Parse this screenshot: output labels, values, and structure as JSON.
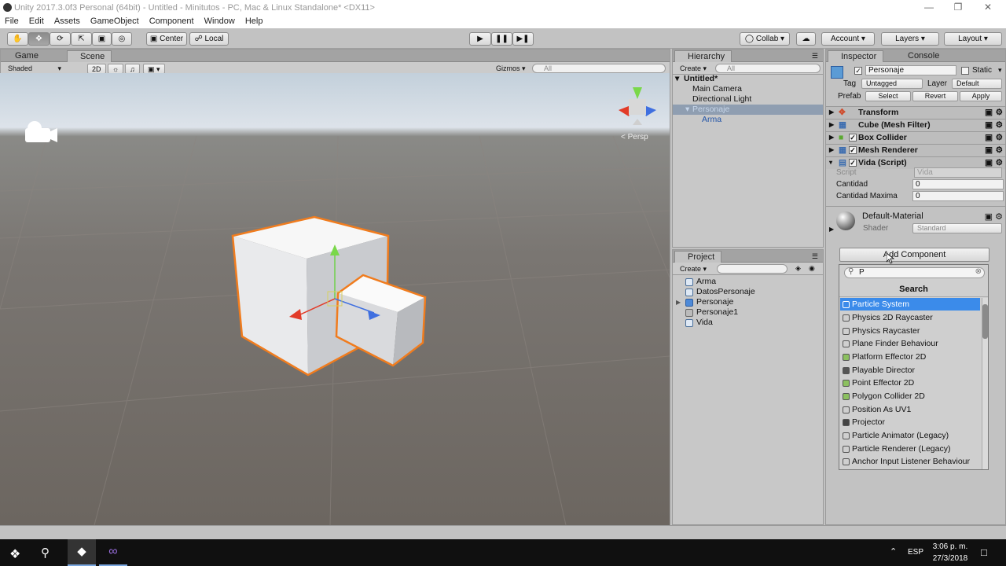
{
  "window": {
    "title": "Unity 2017.3.0f3 Personal (64bit) - Untitled - Minitutos - PC, Mac & Linux Standalone* <DX11>"
  },
  "menu": [
    "File",
    "Edit",
    "Assets",
    "GameObject",
    "Component",
    "Window",
    "Help"
  ],
  "toolbar": {
    "pivot": "Center",
    "space": "Local",
    "collab": "Collab",
    "account": "Account",
    "layers": "Layers",
    "layout": "Layout"
  },
  "scene_panel": {
    "tabs": [
      "Game",
      "Scene"
    ],
    "shading": "Shaded",
    "mode_2d": "2D",
    "gizmos": "Gizmos",
    "search_placeholder": "All",
    "persp_label": "< Persp"
  },
  "hierarchy": {
    "tab": "Hierarchy",
    "create": "Create",
    "search_placeholder": "All",
    "scene_name": "Untitled*",
    "items": [
      "Main Camera",
      "Directional Light",
      "Personaje",
      "Arma"
    ]
  },
  "project": {
    "tab": "Project",
    "create": "Create",
    "items": [
      "Arma",
      "DatosPersonaje",
      "Personaje",
      "Personaje1",
      "Vida"
    ]
  },
  "inspector": {
    "tabs": [
      "Inspector",
      "Console"
    ],
    "object_name": "Personaje",
    "static_label": "Static",
    "tag_label": "Tag",
    "tag_value": "Untagged",
    "layer_label": "Layer",
    "layer_value": "Default",
    "prefab_label": "Prefab",
    "prefab_buttons": [
      "Select",
      "Revert",
      "Apply"
    ],
    "components": [
      "Transform",
      "Cube (Mesh Filter)",
      "Box Collider",
      "Mesh Renderer",
      "Vida (Script)"
    ],
    "script_label": "Script",
    "script_value": "Vida",
    "fields": [
      {
        "label": "Cantidad",
        "value": "0"
      },
      {
        "label": "Cantidad Maxima",
        "value": "0"
      }
    ],
    "material_name": "Default-Material",
    "shader_label": "Shader",
    "shader_value": "Standard",
    "add_component": "Add Component",
    "search_value": "P",
    "search_header": "Search",
    "results": [
      "Particle System",
      "Physics 2D Raycaster",
      "Physics Raycaster",
      "Plane Finder Behaviour",
      "Platform Effector 2D",
      "Playable Director",
      "Point Effector 2D",
      "Polygon Collider 2D",
      "Position As UV1",
      "Projector",
      "Particle Animator (Legacy)",
      "Particle Renderer (Legacy)",
      "Anchor Input Listener Behaviour"
    ]
  },
  "taskbar": {
    "language": "ESP",
    "time": "3:06 p. m.",
    "date": "27/3/2018"
  },
  "colors": {
    "selection_blue": "#3b8bea",
    "outline_orange": "#f07c1e",
    "panel_gray": "#c2c2c2"
  }
}
